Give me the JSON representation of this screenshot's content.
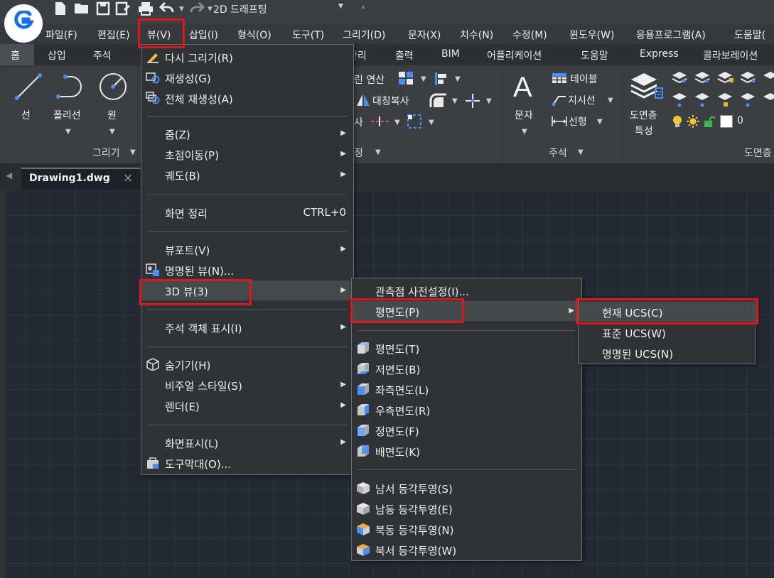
{
  "qa": {
    "workspace": "2D 드래프팅"
  },
  "menubar": [
    "파일(F)",
    "편집(E)",
    "뷰(V)",
    "삽입(I)",
    "형식(O)",
    "도구(T)",
    "그리기(D)",
    "문자(X)",
    "치수(N)",
    "수정(M)",
    "윈도우(W)",
    "응용프로그램(A)",
    "도움말("
  ],
  "ribbon_tabs": [
    "홈",
    "삽입",
    "주석",
    "관리",
    "출력",
    "BIM",
    "어플리케이션",
    "도움말",
    "Express",
    "콜라보레이션"
  ],
  "ribbon": {
    "draw": {
      "line": "선",
      "polyline": "폴리선",
      "circle": "원",
      "panel": "그리기"
    },
    "modify": {
      "boolean": "린 연산",
      "mirror": "대칭복사",
      "copy": "사",
      "panel": "정"
    },
    "annotation": {
      "text": "문자",
      "table": "테이블",
      "leader": "지시선",
      "linear": "선형",
      "panel": "주석"
    },
    "layer": {
      "props_1": "도면층",
      "props_2": "특성",
      "current": "0",
      "panel": "도면층"
    }
  },
  "doc_tab": {
    "name": "Drawing1.dwg",
    "close": "×"
  },
  "view_menu": [
    {
      "label": "다시 그리기(R)"
    },
    {
      "label": "재생성(G)"
    },
    {
      "label": "전체 재생성(A)"
    },
    {
      "label": "줌(Z)"
    },
    {
      "label": "초점이동(P)"
    },
    {
      "label": "궤도(B)"
    },
    {
      "label": "화면 정리",
      "shortcut": "CTRL+0"
    },
    {
      "label": "뷰포트(V)"
    },
    {
      "label": "명명된 뷰(N)..."
    },
    {
      "label": "3D 뷰(3)"
    },
    {
      "label": "주석 객체 표시(I)"
    },
    {
      "label": "숨기기(H)"
    },
    {
      "label": "비주얼 스타일(S)"
    },
    {
      "label": "렌더(E)"
    },
    {
      "label": "화면표시(L)"
    },
    {
      "label": "도구막대(O)..."
    }
  ],
  "view3d_menu": [
    {
      "label": "관측점 사전설정(I)..."
    },
    {
      "label": "평면도(P)"
    },
    {
      "label": "평면도(T)"
    },
    {
      "label": "저면도(B)"
    },
    {
      "label": "좌측면도(L)"
    },
    {
      "label": "우측면도(R)"
    },
    {
      "label": "정면도(F)"
    },
    {
      "label": "배면도(K)"
    },
    {
      "label": "남서 등각투영(S)"
    },
    {
      "label": "남동 등각투영(E)"
    },
    {
      "label": "북동 등각투영(N)"
    },
    {
      "label": "북서 등각투영(W)"
    }
  ],
  "plan_menu": [
    {
      "label": "현재 UCS(C)"
    },
    {
      "label": "표준 UCS(W)"
    },
    {
      "label": "명명된 UCS(N)"
    }
  ],
  "colors": {
    "highlight_border": "#e0161b",
    "menu_bg": "#2f3236",
    "canvas": "#232a36"
  }
}
